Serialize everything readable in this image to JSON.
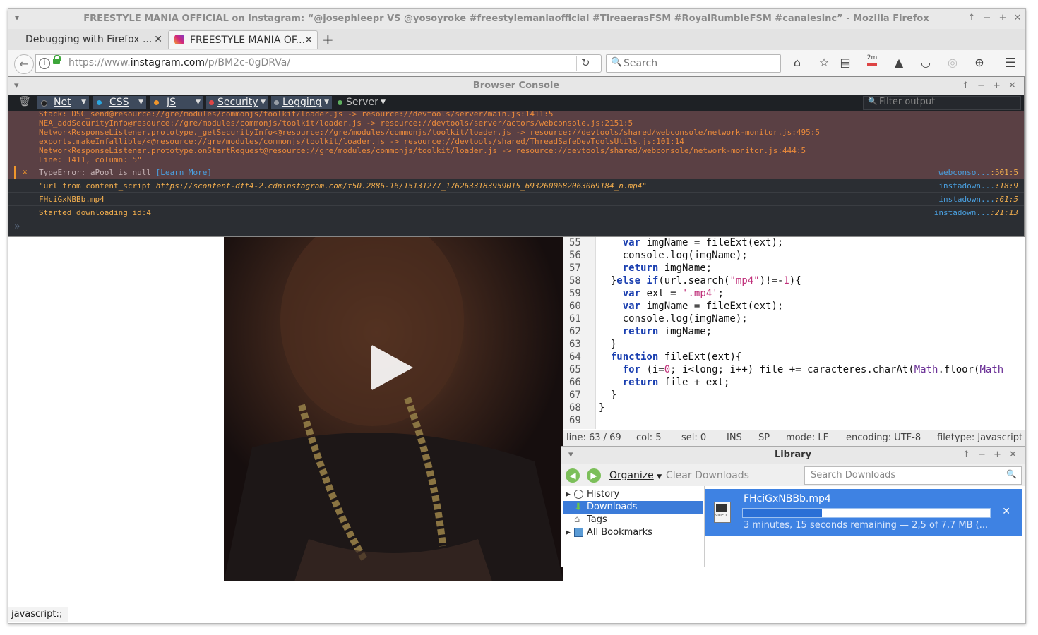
{
  "window": {
    "title": "FREESTYLE MANIA OFFICIAL on Instagram: “@josephleepr VS @yosoyroke #freestylemaniaofficial #TireaerasFSM #RoyalRumbleFSM #canalesinc” - Mozilla Firefox"
  },
  "tabs": [
    {
      "label": "Debugging with Firefox ...",
      "active": false
    },
    {
      "label": "FREESTYLE MANIA OF...",
      "active": true
    }
  ],
  "nav": {
    "url_prefix": "https://www.",
    "url_domain": "instagram.com",
    "url_path": "/p/BM2c-0gDRVa/",
    "search_placeholder": "Search",
    "badge_text": "2m"
  },
  "console": {
    "title": "Browser Console",
    "filters": [
      {
        "label": "Net",
        "color": "#222222"
      },
      {
        "label": "CSS",
        "color": "#2aa7e0"
      },
      {
        "label": "JS",
        "color": "#f0962c"
      },
      {
        "label": "Security",
        "color": "#e04545"
      },
      {
        "label": "Logging",
        "color": "#9aa0a8"
      },
      {
        "label": "Server",
        "color": "#5fb05f"
      }
    ],
    "filter_placeholder": "Filter output",
    "stack_lines": [
      "Stack: DSC_send@resource://gre/modules/commonjs/toolkit/loader.js -> resource://devtools/server/main.js:1411:5",
      "NEA_addSecurityInfo@resource://gre/modules/commonjs/toolkit/loader.js -> resource://devtools/server/actors/webconsole.js:2151:5",
      "NetworkResponseListener.prototype._getSecurityInfo<@resource://gre/modules/commonjs/toolkit/loader.js -> resource://devtools/shared/webconsole/network-monitor.js:495:5",
      "exports.makeInfallible/<@resource://gre/modules/commonjs/toolkit/loader.js -> resource://devtools/shared/ThreadSafeDevToolsUtils.js:101:14",
      "NetworkResponseListener.prototype.onStartRequest@resource://gre/modules/commonjs/toolkit/loader.js -> resource://devtools/shared/webconsole/network-monitor.js:444:5",
      "Line: 1411, column: 5\""
    ],
    "error": {
      "text": "TypeError: aPool is null",
      "link": "[Learn More]",
      "source": "webconso...",
      "loc": ":501:5"
    },
    "messages": [
      {
        "text": "\"url from content_script ",
        "url": "https://scontent-dft4-2.cdninstagram.com/t50.2886-16/15131277_1762633183959015_6932600682063069184_n.mp4\"",
        "source": "instadown...",
        "loc": ":18:9"
      },
      {
        "text": "FHciGxNBBb.mp4",
        "url": "",
        "source": "instadown...",
        "loc": ":61:5"
      },
      {
        "text": "Started downloading id:4",
        "url": "",
        "source": "instadown...",
        "loc": ":21:13"
      }
    ],
    "prompt": "»"
  },
  "editor": {
    "line_numbers": [
      "55",
      "56",
      "57",
      "58",
      "59",
      "60",
      "61",
      "62",
      "63",
      "64",
      "65",
      "66",
      "67",
      "68",
      "69"
    ],
    "status": {
      "line": "line: 63 / 69",
      "col": "col: 5",
      "sel": "sel: 0",
      "ins": "INS",
      "sp": "SP",
      "mode": "mode: LF",
      "encoding": "encoding: UTF-8",
      "filetype": "filetype: Javascript"
    }
  },
  "library": {
    "title": "Library",
    "organize": "Organize",
    "clear": "Clear Downloads",
    "search_placeholder": "Search Downloads",
    "tree": [
      {
        "label": "History",
        "expandable": true
      },
      {
        "label": "Downloads",
        "expandable": false,
        "selected": true
      },
      {
        "label": "Tags",
        "expandable": false
      },
      {
        "label": "All Bookmarks",
        "expandable": true
      }
    ],
    "download": {
      "filename": "FHciGxNBBb.mp4",
      "status": "3 minutes, 15 seconds remaining — 2,5 of 7,7 MB (...",
      "progress": 0.32,
      "icon_label": "VIDEO"
    }
  },
  "status_tooltip": "javascript:;"
}
